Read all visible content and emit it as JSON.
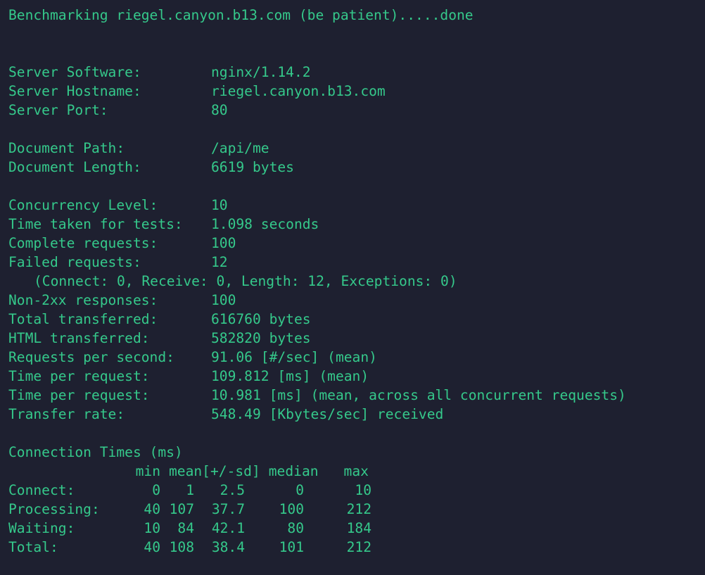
{
  "banner": "Benchmarking riegel.canyon.b13.com (be patient).....done",
  "server": [
    {
      "key": "Server Software:",
      "value": "nginx/1.14.2"
    },
    {
      "key": "Server Hostname:",
      "value": "riegel.canyon.b13.com"
    },
    {
      "key": "Server Port:",
      "value": "80"
    }
  ],
  "document": [
    {
      "key": "Document Path:",
      "value": "/api/me"
    },
    {
      "key": "Document Length:",
      "value": "6619 bytes"
    }
  ],
  "stats": {
    "concurrency": {
      "key": "Concurrency Level:",
      "value": "10"
    },
    "time_taken": {
      "key": "Time taken for tests:",
      "value": "1.098 seconds"
    },
    "complete": {
      "key": "Complete requests:",
      "value": "100"
    },
    "failed": {
      "key": "Failed requests:",
      "value": "12"
    },
    "failed_detail": "(Connect: 0, Receive: 0, Length: 12, Exceptions: 0)",
    "non2xx": {
      "key": "Non-2xx responses:",
      "value": "100"
    },
    "total_transferred": {
      "key": "Total transferred:",
      "value": "616760 bytes"
    },
    "html_transferred": {
      "key": "HTML transferred:",
      "value": "582820 bytes"
    },
    "rps": {
      "key": "Requests per second:",
      "value": "91.06 [#/sec] (mean)"
    },
    "tpr1": {
      "key": "Time per request:",
      "value": "109.812 [ms] (mean)"
    },
    "tpr2": {
      "key": "Time per request:",
      "value": "10.981 [ms] (mean, across all concurrent requests)"
    },
    "transfer_rate": {
      "key": "Transfer rate:",
      "value": "548.49 [Kbytes/sec] received"
    }
  },
  "connection_times": {
    "title": "Connection Times (ms)",
    "headers": [
      "min",
      "mean[+/-sd]",
      "median",
      "max"
    ],
    "rows": [
      {
        "label": "Connect:",
        "min": "0",
        "mean": "1",
        "sd": "2.5",
        "median": "0",
        "max": "10"
      },
      {
        "label": "Processing:",
        "min": "40",
        "mean": "107",
        "sd": "37.7",
        "median": "100",
        "max": "212"
      },
      {
        "label": "Waiting:",
        "min": "10",
        "mean": "84",
        "sd": "42.1",
        "median": "80",
        "max": "184"
      },
      {
        "label": "Total:",
        "min": "40",
        "mean": "108",
        "sd": "38.4",
        "median": "101",
        "max": "212"
      }
    ]
  }
}
